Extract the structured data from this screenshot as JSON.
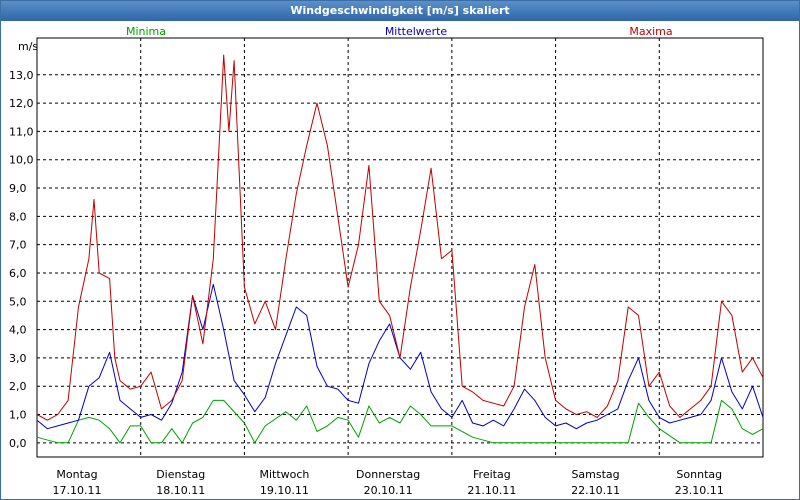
{
  "window": {
    "title": "Windgeschwindigkeit [m/s] skaliert"
  },
  "chart_data": {
    "type": "line",
    "title": "Windgeschwindigkeit [m/s] skaliert",
    "ylabel": "m/s",
    "ylim": [
      -0.5,
      14.3
    ],
    "yticks": [
      "0,0",
      "1,0",
      "2,0",
      "3,0",
      "4,0",
      "5,0",
      "6,0",
      "7,0",
      "8,0",
      "9,0",
      "10,0",
      "11,0",
      "12,0",
      "13,0"
    ],
    "ytick_values": [
      0,
      1,
      2,
      3,
      4,
      5,
      6,
      7,
      8,
      9,
      10,
      11,
      12,
      13
    ],
    "xlim": [
      0,
      7
    ],
    "x_ticks": [
      {
        "day": "Montag",
        "date": "17.10.11",
        "x": 0
      },
      {
        "day": "Dienstag",
        "date": "18.10.11",
        "x": 1
      },
      {
        "day": "Mittwoch",
        "date": "19.10.11",
        "x": 2
      },
      {
        "day": "Donnerstag",
        "date": "20.10.11",
        "x": 3
      },
      {
        "day": "Freitag",
        "date": "21.10.11",
        "x": 4
      },
      {
        "day": "Samstag",
        "date": "22.10.11",
        "x": 5
      },
      {
        "day": "Sonntag",
        "date": "23.10.11",
        "x": 6
      }
    ],
    "grid": true,
    "legend_placement": "top",
    "series": [
      {
        "name": "Minima",
        "color": "#00a000",
        "x": [
          0,
          0.2,
          0.3,
          0.4,
          0.5,
          0.6,
          0.7,
          0.8,
          0.9,
          1.0,
          1.1,
          1.2,
          1.3,
          1.4,
          1.5,
          1.6,
          1.7,
          1.8,
          2.0,
          2.1,
          2.2,
          2.4,
          2.5,
          2.6,
          2.7,
          2.8,
          2.9,
          3.0,
          3.1,
          3.2,
          3.3,
          3.4,
          3.5,
          3.6,
          3.7,
          3.8,
          4.0,
          4.2,
          4.4,
          4.6,
          4.8,
          4.85,
          4.95,
          5.0,
          5.2,
          5.4,
          5.5,
          5.6,
          5.7,
          5.8,
          5.9,
          6.0,
          6.2,
          6.4,
          6.5,
          6.6,
          6.7,
          6.8,
          6.9,
          7.0
        ],
        "values": [
          0.2,
          0.0,
          0.0,
          0.8,
          0.9,
          0.8,
          0.5,
          0.0,
          0.6,
          0.6,
          0.0,
          0.0,
          0.5,
          0.0,
          0.7,
          0.9,
          1.5,
          1.5,
          0.7,
          0.0,
          0.6,
          1.1,
          0.8,
          1.3,
          0.4,
          0.6,
          0.9,
          0.8,
          0.2,
          1.3,
          0.7,
          0.9,
          0.7,
          1.3,
          1.0,
          0.6,
          0.6,
          0.2,
          0.0,
          0.0,
          0.0,
          0.0,
          0.0,
          0.0,
          0.0,
          0.0,
          0.0,
          0.0,
          0.0,
          1.4,
          0.9,
          0.5,
          0.0,
          0.0,
          0.0,
          1.5,
          1.2,
          0.5,
          0.3,
          0.5
        ]
      },
      {
        "name": "Mittelwerte",
        "color": "#0000c0",
        "x": [
          0,
          0.1,
          0.2,
          0.3,
          0.4,
          0.5,
          0.6,
          0.7,
          0.8,
          0.9,
          1.0,
          1.1,
          1.2,
          1.3,
          1.4,
          1.5,
          1.6,
          1.7,
          1.8,
          1.9,
          2.0,
          2.1,
          2.2,
          2.3,
          2.4,
          2.5,
          2.6,
          2.7,
          2.8,
          2.9,
          3.0,
          3.1,
          3.2,
          3.3,
          3.4,
          3.5,
          3.6,
          3.7,
          3.8,
          3.9,
          4.0,
          4.1,
          4.2,
          4.3,
          4.4,
          4.5,
          4.6,
          4.7,
          4.8,
          4.9,
          5.0,
          5.1,
          5.2,
          5.3,
          5.4,
          5.5,
          5.6,
          5.7,
          5.8,
          5.9,
          6.0,
          6.1,
          6.2,
          6.3,
          6.4,
          6.5,
          6.6,
          6.7,
          6.8,
          6.9,
          7.0
        ],
        "values": [
          0.8,
          0.5,
          0.6,
          0.7,
          0.8,
          2.0,
          2.3,
          3.2,
          1.5,
          1.2,
          0.9,
          1.0,
          0.8,
          1.4,
          2.5,
          5.2,
          4.0,
          5.6,
          4.0,
          2.2,
          1.7,
          1.1,
          1.6,
          2.8,
          3.8,
          4.8,
          4.5,
          2.7,
          2.0,
          1.9,
          1.5,
          1.4,
          2.8,
          3.6,
          4.2,
          3.0,
          2.6,
          3.2,
          1.8,
          1.2,
          0.9,
          1.5,
          0.7,
          0.6,
          0.8,
          0.6,
          1.2,
          1.9,
          1.5,
          0.9,
          0.6,
          0.7,
          0.5,
          0.7,
          0.8,
          1.0,
          1.2,
          2.2,
          3.0,
          1.5,
          0.9,
          0.7,
          0.8,
          0.9,
          1.0,
          1.5,
          3.0,
          1.8,
          1.2,
          2.0,
          0.9
        ]
      },
      {
        "name": "Maxima",
        "color": "#c00000",
        "x": [
          0,
          0.1,
          0.2,
          0.3,
          0.4,
          0.5,
          0.55,
          0.6,
          0.7,
          0.75,
          0.8,
          0.9,
          1.0,
          1.1,
          1.2,
          1.3,
          1.4,
          1.5,
          1.6,
          1.7,
          1.8,
          1.85,
          1.9,
          2.0,
          2.1,
          2.2,
          2.3,
          2.4,
          2.5,
          2.6,
          2.7,
          2.8,
          2.9,
          3.0,
          3.1,
          3.2,
          3.3,
          3.4,
          3.5,
          3.6,
          3.7,
          3.8,
          3.9,
          4.0,
          4.1,
          4.2,
          4.3,
          4.4,
          4.5,
          4.6,
          4.7,
          4.8,
          4.9,
          5.0,
          5.1,
          5.2,
          5.3,
          5.4,
          5.5,
          5.6,
          5.7,
          5.8,
          5.9,
          6.0,
          6.1,
          6.2,
          6.3,
          6.4,
          6.5,
          6.6,
          6.7,
          6.8,
          6.9,
          7.0
        ],
        "values": [
          1.0,
          0.8,
          1.0,
          1.5,
          4.8,
          6.5,
          8.6,
          6.0,
          5.8,
          3.0,
          2.2,
          1.9,
          2.0,
          2.5,
          1.2,
          1.5,
          2.2,
          5.2,
          3.5,
          6.5,
          13.7,
          11.0,
          13.5,
          5.5,
          4.2,
          5.0,
          4.0,
          6.5,
          8.8,
          10.5,
          12.0,
          10.5,
          8.0,
          5.5,
          7.0,
          9.8,
          5.0,
          4.5,
          3.0,
          5.5,
          7.5,
          9.7,
          6.5,
          6.8,
          2.0,
          1.8,
          1.5,
          1.4,
          1.3,
          2.0,
          4.8,
          6.3,
          3.0,
          1.5,
          1.2,
          1.0,
          1.1,
          0.9,
          1.3,
          2.2,
          4.8,
          4.5,
          2.0,
          2.5,
          1.3,
          0.9,
          1.2,
          1.5,
          2.0,
          5.0,
          4.5,
          2.5,
          3.0,
          2.3
        ]
      }
    ]
  }
}
